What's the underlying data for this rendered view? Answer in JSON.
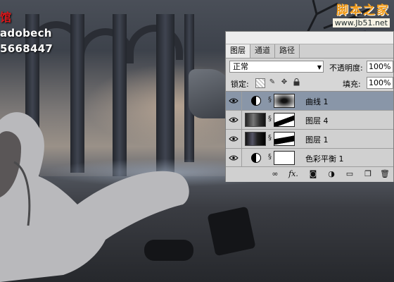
{
  "watermark_left": {
    "line1": "adobech",
    "red_char": "馆",
    "line2": "5668447"
  },
  "watermark_right": {
    "title": "脚本之家",
    "url": "www.Jb51.net"
  },
  "layers_panel": {
    "tabs": [
      {
        "label": "图层",
        "active": true
      },
      {
        "label": "通道",
        "active": false
      },
      {
        "label": "路径",
        "active": false
      }
    ],
    "blend_mode": "正常",
    "opacity_label": "不透明度:",
    "opacity_value": "100%",
    "lock_label": "锁定:",
    "fill_label": "填充:",
    "fill_value": "100%",
    "layers": [
      {
        "name": "曲线 1",
        "type": "adjustment",
        "selected": true
      },
      {
        "name": "图层 4",
        "type": "image",
        "selected": false
      },
      {
        "name": "图层 1",
        "type": "image",
        "selected": false
      },
      {
        "name": "色彩平衡 1",
        "type": "adjustment",
        "selected": false
      }
    ],
    "footer_icons": [
      "link-icon",
      "fx-icon",
      "mask-icon",
      "adjustment-icon",
      "group-folder-icon",
      "new-layer-icon",
      "trash-icon"
    ]
  },
  "colors": {
    "panel_bg": "#d6d6d6",
    "selected_row": "#8996a8",
    "watermark_red": "#d8171a",
    "watermark_orange": "#f29a16"
  }
}
